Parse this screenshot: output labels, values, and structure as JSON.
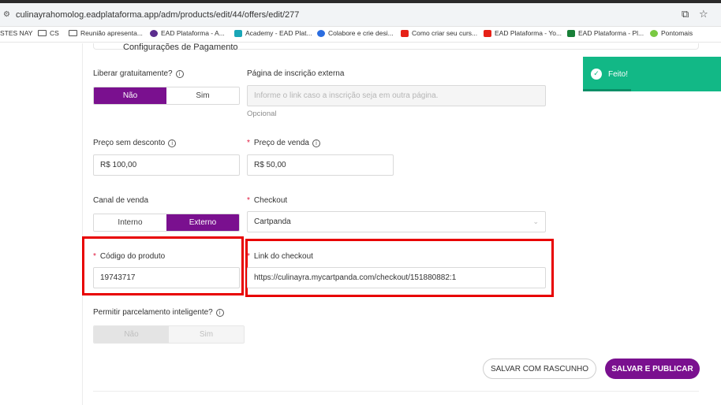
{
  "browser": {
    "url": "culinayrahomolog.eadplataforma.app/adm/products/edit/44/offers/edit/277",
    "bookmarks": [
      {
        "label": "STES NAY",
        "color": "transparent"
      },
      {
        "label": "CS",
        "color": "folder"
      },
      {
        "label": "Reunião apresenta...",
        "color": "folder"
      },
      {
        "label": "EAD Plataforma - A...",
        "color": "#5b2d8e"
      },
      {
        "label": "Academy - EAD Plat...",
        "color": "#1aa6b7"
      },
      {
        "label": "Colabore e crie desi...",
        "color": "#2b6de0"
      },
      {
        "label": "Como criar seu curs...",
        "color": "#e62117"
      },
      {
        "label": "EAD Plataforma - Yo...",
        "color": "#e62117"
      },
      {
        "label": "EAD Plataforma - Pl...",
        "color": "#188038"
      },
      {
        "label": "Pontomais",
        "color": "#7ac943"
      }
    ]
  },
  "section": {
    "title": "Configurações de Pagamento"
  },
  "form": {
    "free": {
      "label": "Liberar gratuitamente?",
      "options": [
        "Não",
        "Sim"
      ],
      "selected": "Não"
    },
    "external_page": {
      "label": "Página de inscrição externa",
      "placeholder": "Informe o link caso a inscrição seja em outra página.",
      "helper": "Opcional"
    },
    "price_no_discount": {
      "label": "Preço sem desconto",
      "value": "R$ 100,00"
    },
    "sale_price": {
      "label": "Preço de venda",
      "value": "R$ 50,00"
    },
    "channel": {
      "label": "Canal de venda",
      "options": [
        "Interno",
        "Externo"
      ],
      "selected": "Externo"
    },
    "checkout": {
      "label": "Checkout",
      "value": "Cartpanda"
    },
    "product_code": {
      "label": "Código do produto",
      "value": "19743717"
    },
    "checkout_link": {
      "label": "Link do checkout",
      "value": "https://culinayra.mycartpanda.com/checkout/151880882:1"
    },
    "installments": {
      "label": "Permitir parcelamento inteligente?",
      "options": [
        "Não",
        "Sim"
      ],
      "selected": "Não"
    }
  },
  "actions": {
    "draft_label": "SALVAR COM RASCUNHO",
    "publish_label": "SALVAR E PUBLICAR"
  },
  "toast": {
    "message": "Feito!",
    "progress": 0.35
  },
  "colors": {
    "primary": "#7a108f",
    "required": "#e0173c",
    "highlight": "#e80000",
    "success": "#12b886"
  }
}
